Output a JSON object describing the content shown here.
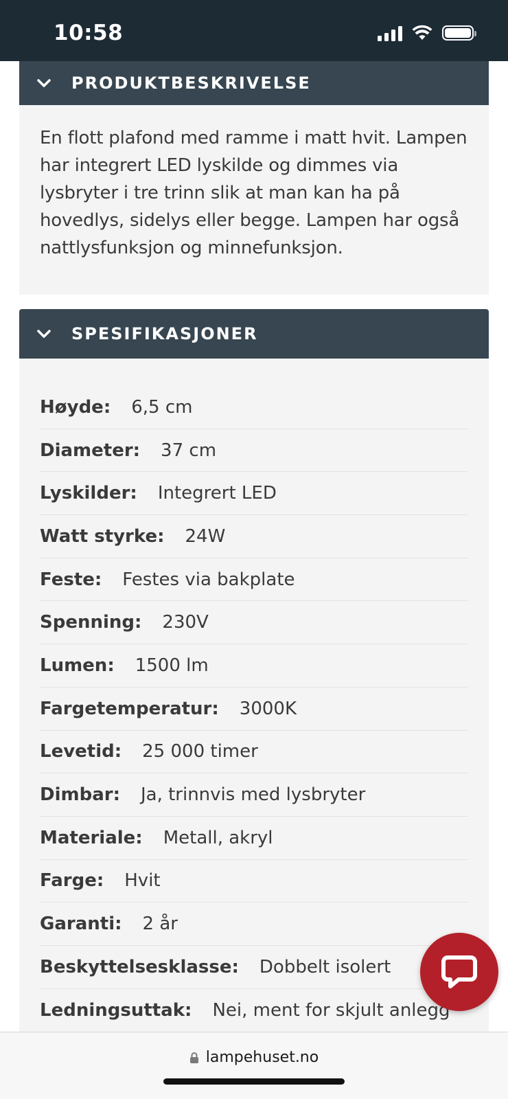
{
  "status_bar": {
    "time": "10:58"
  },
  "description": {
    "header": "PRODUKTBESKRIVELSE",
    "text": "En flott plafond med ramme i matt hvit. Lampen har integrert LED lyskilde og dimmes via lysbryter i tre trinn slik at man kan ha på hovedlys, sidelys eller begge. Lampen har også nattlysfunksjon og minnefunksjon."
  },
  "specifications": {
    "header": "SPESIFIKASJONER",
    "rows": [
      {
        "key": "Høyde:",
        "value": "6,5 cm"
      },
      {
        "key": "Diameter:",
        "value": "37 cm"
      },
      {
        "key": "Lyskilder:",
        "value": "Integrert LED"
      },
      {
        "key": "Watt styrke:",
        "value": "24W"
      },
      {
        "key": "Feste:",
        "value": "Festes via bakplate"
      },
      {
        "key": "Spenning:",
        "value": "230V"
      },
      {
        "key": "Lumen:",
        "value": "1500 lm"
      },
      {
        "key": "Fargetemperatur:",
        "value": "3000K"
      },
      {
        "key": "Levetid:",
        "value": "25 000 timer"
      },
      {
        "key": "Dimbar:",
        "value": "Ja, trinnvis med lysbryter"
      },
      {
        "key": "Materiale:",
        "value": "Metall, akryl"
      },
      {
        "key": "Farge:",
        "value": "Hvit"
      },
      {
        "key": "Garanti:",
        "value": "2 år"
      },
      {
        "key": "Beskyttelsesklasse:",
        "value": "Dobbelt isolert"
      },
      {
        "key": "Ledningsuttak:",
        "value": "Nei, ment for skjult anlegg"
      }
    ]
  },
  "browser": {
    "url": "lampehuset.no"
  },
  "colors": {
    "status_bar": "#1d2b35",
    "section_header": "#374650",
    "section_body": "#f4f4f4",
    "chat_button": "#b3202a"
  },
  "icons": {
    "chevron": "chevron-down-icon",
    "chat": "chat-bubble-icon",
    "lock": "lock-icon"
  }
}
